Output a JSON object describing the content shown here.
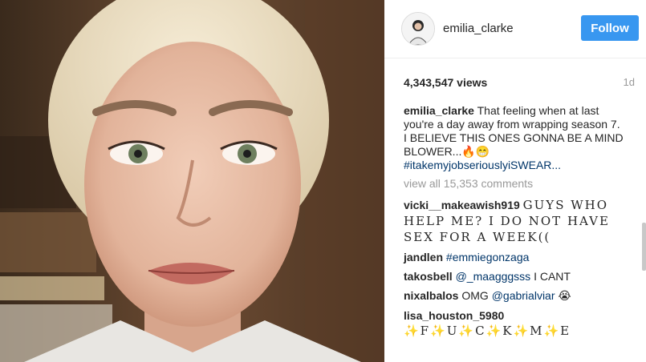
{
  "post": {
    "image_alt": "Selfie video of a woman with platinum blonde hair"
  },
  "header": {
    "username": "emilia_clarke",
    "follow_label": "Follow",
    "avatar_icon": "profile-avatar-icon"
  },
  "stats": {
    "views": "4,343,547 views",
    "age": "1d"
  },
  "caption": {
    "author": "emilia_clarke",
    "text": "That feeling when at last you're a day away from wrapping season 7.",
    "line2": "I BELIEVE THIS ONES GONNA BE A MIND BLOWER...🔥😁",
    "hashtag": "#itakemyjobseriouslyiSWEAR..."
  },
  "view_all": "view all 15,353 comments",
  "comments": [
    {
      "author": "vicki__makeawish919",
      "text": "GUYS WHO HELP ME? I DO NOT HAVE SEX FOR A WEEK(("
    },
    {
      "author": "jandlen",
      "mention": "#emmiegonzaga"
    },
    {
      "author": "takosbell",
      "mention": "@_maagggsss",
      "text": "I CANT"
    },
    {
      "author": "nixalbalos",
      "pre": "OMG",
      "mention": "@gabrialviar",
      "emoji": "😭"
    },
    {
      "author": "lisa_houston_5980",
      "text": "✨F✨U✨C✨K✨M✨E"
    }
  ],
  "colors": {
    "accent": "#3897f0",
    "link": "#003569",
    "muted": "#999999"
  }
}
